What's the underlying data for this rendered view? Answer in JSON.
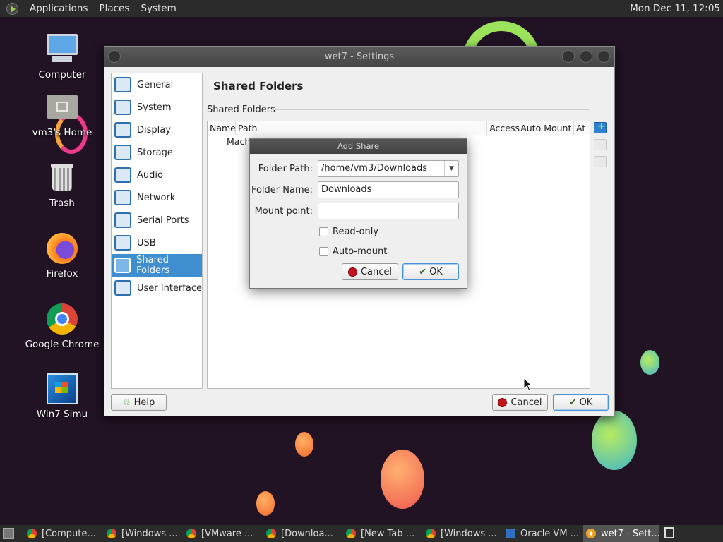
{
  "topbar": {
    "menus": [
      "Applications",
      "Places",
      "System"
    ],
    "clock": "Mon Dec 11, 12:05"
  },
  "desktop_icons": [
    {
      "label": "Computer",
      "icon": "computer-icon"
    },
    {
      "label": "vm3's Home",
      "icon": "home-folder-icon"
    },
    {
      "label": "Trash",
      "icon": "trash-icon"
    },
    {
      "label": "Firefox",
      "icon": "firefox-icon"
    },
    {
      "label": "Google Chrome",
      "icon": "chrome-icon"
    },
    {
      "label": "Win7 Simu",
      "icon": "win7-icon"
    }
  ],
  "settings_window": {
    "title": "wet7 - Settings",
    "sidebar": [
      {
        "label": "General",
        "icon": "general-icon"
      },
      {
        "label": "System",
        "icon": "system-icon"
      },
      {
        "label": "Display",
        "icon": "display-icon"
      },
      {
        "label": "Storage",
        "icon": "storage-icon"
      },
      {
        "label": "Audio",
        "icon": "audio-icon"
      },
      {
        "label": "Network",
        "icon": "network-icon"
      },
      {
        "label": "Serial Ports",
        "icon": "serial-ports-icon"
      },
      {
        "label": "USB",
        "icon": "usb-icon"
      },
      {
        "label": "Shared Folders",
        "icon": "shared-folders-icon",
        "active": true
      },
      {
        "label": "User Interface",
        "icon": "user-interface-icon"
      }
    ],
    "page_title": "Shared Folders",
    "section_label": "Shared Folders",
    "table": {
      "columns": [
        "Name",
        "Path",
        "Access",
        "Auto Mount",
        "At"
      ],
      "rows": [
        "Machine Folders"
      ]
    },
    "buttons": {
      "help": "Help",
      "cancel": "Cancel",
      "ok": "OK"
    }
  },
  "add_share_dialog": {
    "title": "Add Share",
    "folder_path_label": "Folder Path:",
    "folder_path_value": "/home/vm3/Downloads",
    "folder_name_label": "Folder Name:",
    "folder_name_value": "Downloads",
    "mount_point_label": "Mount point:",
    "mount_point_value": "",
    "read_only_label": "Read-only",
    "read_only_checked": false,
    "auto_mount_label": "Auto-mount",
    "auto_mount_checked": false,
    "cancel_label": "Cancel",
    "ok_label": "OK"
  },
  "taskbar": {
    "items": [
      {
        "label": "[Compute...",
        "icon": "chrome-icon"
      },
      {
        "label": "[Windows ...",
        "icon": "chrome-icon"
      },
      {
        "label": "[VMware ...",
        "icon": "chrome-icon"
      },
      {
        "label": "[Downloa...",
        "icon": "chrome-icon"
      },
      {
        "label": "[New Tab ...",
        "icon": "chrome-icon"
      },
      {
        "label": "[Windows ...",
        "icon": "chrome-icon"
      },
      {
        "label": "Oracle VM ...",
        "icon": "virtualbox-icon"
      },
      {
        "label": "wet7 - Sett...",
        "icon": "settings-gear-icon",
        "active": true
      }
    ]
  }
}
